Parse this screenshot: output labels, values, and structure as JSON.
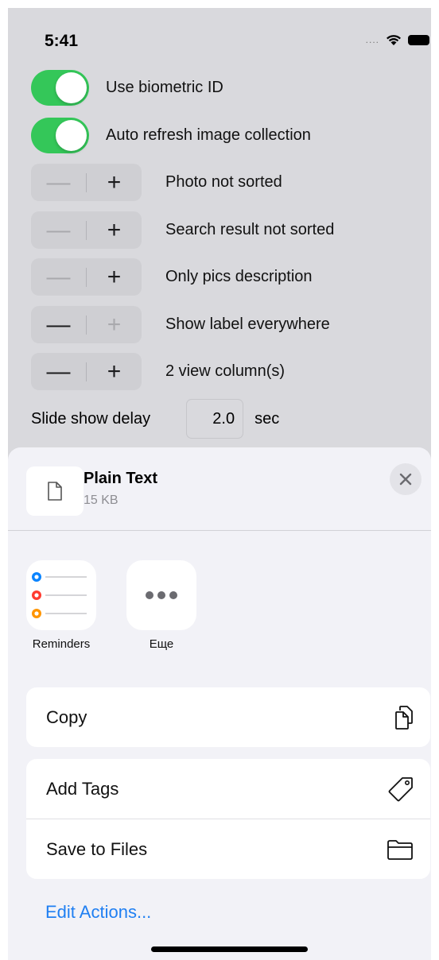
{
  "status_bar": {
    "time": "5:41",
    "signal_dots": "....",
    "wifi_icon": "wifi-icon",
    "battery_icon": "battery-icon"
  },
  "settings": {
    "toggles": [
      {
        "label": "Use biometric ID",
        "on": true
      },
      {
        "label": "Auto refresh image collection",
        "on": true
      }
    ],
    "steppers": [
      {
        "label": "Photo not sorted",
        "minus_enabled": false,
        "plus_enabled": true
      },
      {
        "label": "Search result not sorted",
        "minus_enabled": false,
        "plus_enabled": true
      },
      {
        "label": "Only pics description",
        "minus_enabled": false,
        "plus_enabled": true
      },
      {
        "label": "Show label everywhere",
        "minus_enabled": true,
        "plus_enabled": false
      },
      {
        "label": "2 view column(s)",
        "minus_enabled": true,
        "plus_enabled": true
      }
    ],
    "stepper_minus_glyph": "—",
    "stepper_plus_glyph": "+",
    "slide_show": {
      "label": "Slide show delay",
      "value": "2.0",
      "unit": "sec"
    }
  },
  "share_sheet": {
    "file": {
      "title": "Plain Text",
      "size": "15 KB",
      "icon": "document-icon"
    },
    "close_icon": "close-icon",
    "apps": [
      {
        "label": "Reminders",
        "icon": "reminders-icon"
      },
      {
        "label": "Еще",
        "icon": "more-icon"
      }
    ],
    "actions_group1": [
      {
        "label": "Copy",
        "icon": "copy-icon"
      }
    ],
    "actions_group2": [
      {
        "label": "Add Tags",
        "icon": "tag-icon"
      },
      {
        "label": "Save to Files",
        "icon": "folder-icon"
      }
    ],
    "edit_actions": "Edit Actions...",
    "colors": {
      "accent": "#1f7ff2",
      "toggle_on": "#34c759",
      "reminder_blue": "#0a84ff",
      "reminder_red": "#ff3b30",
      "reminder_orange": "#ff9500"
    }
  }
}
